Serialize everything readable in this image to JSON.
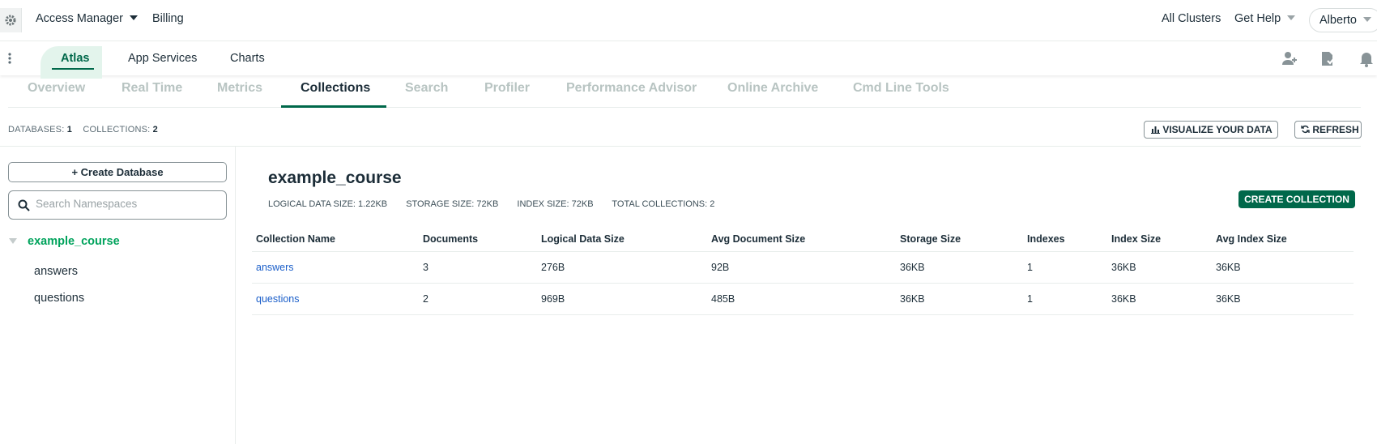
{
  "topbar": {
    "org_menu": "Access Manager",
    "billing": "Billing",
    "all_clusters": "All Clusters",
    "get_help": "Get Help",
    "user": "Alberto"
  },
  "project_nav": {
    "tabs": [
      {
        "label": "Atlas",
        "active": true
      },
      {
        "label": "App Services",
        "active": false
      },
      {
        "label": "Charts",
        "active": false
      }
    ],
    "icons": [
      "kebab-menu-icon",
      "invite-user-icon",
      "activity-feed-icon",
      "bell-icon"
    ]
  },
  "cluster_tabs": [
    {
      "label": "Overview",
      "active": false
    },
    {
      "label": "Real Time",
      "active": false
    },
    {
      "label": "Metrics",
      "active": false
    },
    {
      "label": "Collections",
      "active": true
    },
    {
      "label": "Search",
      "active": false
    },
    {
      "label": "Profiler",
      "active": false
    },
    {
      "label": "Performance Advisor",
      "active": false
    },
    {
      "label": "Online Archive",
      "active": false
    },
    {
      "label": "Cmd Line Tools",
      "active": false
    }
  ],
  "counts": {
    "databases_label": "DATABASES:",
    "databases_value": "1",
    "collections_label": "COLLECTIONS:",
    "collections_value": "2"
  },
  "actions": {
    "visualize": "VISUALIZE YOUR DATA",
    "refresh": "REFRESH",
    "create_collection": "CREATE COLLECTION"
  },
  "sidebar": {
    "create_database": "+ Create Database",
    "search_placeholder": "Search Namespaces",
    "database": "example_course",
    "collections": [
      "answers",
      "questions"
    ]
  },
  "main": {
    "title": "example_course",
    "stats": [
      "LOGICAL DATA SIZE: 1.22KB",
      "STORAGE SIZE: 72KB",
      "INDEX SIZE: 72KB",
      "TOTAL COLLECTIONS: 2"
    ],
    "columns": [
      "Collection Name",
      "Documents",
      "Logical Data Size",
      "Avg Document Size",
      "Storage Size",
      "Indexes",
      "Index Size",
      "Avg Index Size"
    ],
    "rows": [
      [
        "answers",
        "3",
        "276B",
        "92B",
        "36KB",
        "1",
        "36KB",
        "36KB"
      ],
      [
        "questions",
        "2",
        "969B",
        "485B",
        "36KB",
        "1",
        "36KB",
        "36KB"
      ]
    ]
  },
  "colors": {
    "accent": "#00684a",
    "db_green": "#00a35c",
    "link": "#1a5ec9"
  }
}
